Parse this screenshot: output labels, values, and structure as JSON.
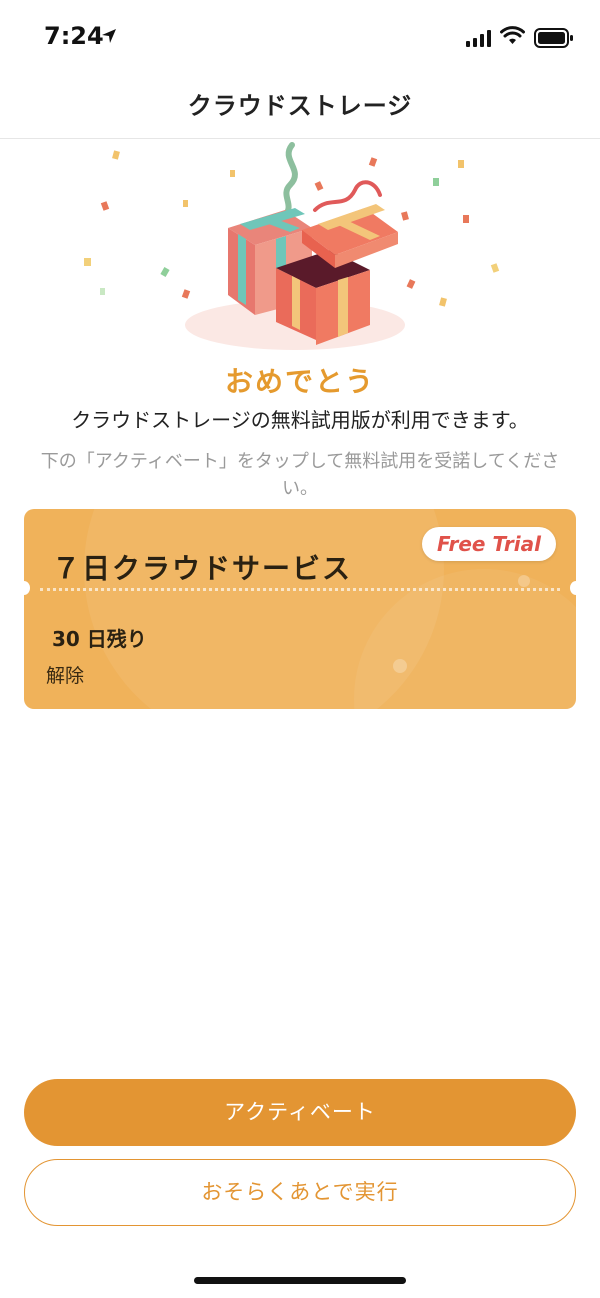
{
  "status": {
    "time": "7:24",
    "icons": [
      "location-arrow-icon",
      "cellular-signal-icon",
      "wifi-icon",
      "battery-icon"
    ]
  },
  "nav": {
    "title": "クラウドストレージ"
  },
  "hero": {
    "icon": "gift-boxes-confetti-illustration"
  },
  "main": {
    "heading": "おめでとう",
    "message": "クラウドストレージの無料試用版が利用できます。",
    "hint": "下の「アクティベート」をタップして無料試用を受諾してください。"
  },
  "card": {
    "title": "７日クラウドサービス",
    "badge": "Free Trial",
    "days_left": "30 日残り",
    "cancel_label": "解除"
  },
  "actions": {
    "activate_label": "アクティベート",
    "later_label": "おそらくあとで実行"
  },
  "colors": {
    "accent": "#e39533",
    "heading": "#e59a2e",
    "card_bg": "#f0b25a",
    "badge_text": "#e0524a"
  }
}
